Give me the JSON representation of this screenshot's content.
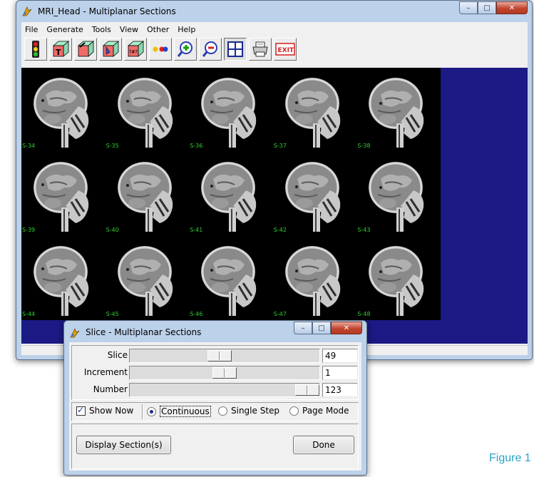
{
  "main_window": {
    "title": "MRI_Head - Multiplanar Sections",
    "caption_buttons": {
      "minimize": "–",
      "maximize": "□",
      "close": "✕"
    },
    "menu": [
      "File",
      "Generate",
      "Tools",
      "View",
      "Other",
      "Help"
    ],
    "toolbar": [
      {
        "name": "traffic-light-icon"
      },
      {
        "name": "transverse-cube-icon"
      },
      {
        "name": "coronal-cube-icon"
      },
      {
        "name": "sagittal-cube-icon"
      },
      {
        "name": "numbered-cube-icon"
      },
      {
        "name": "colored-dots-icon"
      },
      {
        "name": "zoom-in-icon"
      },
      {
        "name": "zoom-out-icon"
      },
      {
        "name": "grid-layout-icon"
      },
      {
        "name": "printer-icon"
      },
      {
        "name": "exit-icon",
        "text": "EXIT"
      }
    ],
    "slices": [
      "S-34",
      "S-35",
      "S-36",
      "S-37",
      "S-38",
      "S-39",
      "S-40",
      "S-41",
      "S-42",
      "S-43",
      "S-44",
      "S-45",
      "S-46",
      "S-47",
      "S-48"
    ],
    "colors": {
      "viewport_background": "#1c1a85",
      "slice_label": "#2fd12f"
    }
  },
  "dialog": {
    "title": "Slice - Multiplanar Sections",
    "caption_buttons": {
      "minimize": "–",
      "maximize": "□",
      "close": "✕"
    },
    "sliders": [
      {
        "label": "Slice",
        "value": "49",
        "position": 0.47
      },
      {
        "label": "Increment",
        "value": "1",
        "position": 0.5
      },
      {
        "label": "Number",
        "value": "123",
        "position": 1.0
      }
    ],
    "show_now": {
      "label": "Show Now",
      "checked": true
    },
    "modes": [
      {
        "label": "Continuous",
        "selected": true
      },
      {
        "label": "Single Step",
        "selected": false
      },
      {
        "label": "Page Mode",
        "selected": false
      }
    ],
    "display_button": "Display Section(s)",
    "done_button": "Done"
  },
  "figure_caption": "Figure 1"
}
